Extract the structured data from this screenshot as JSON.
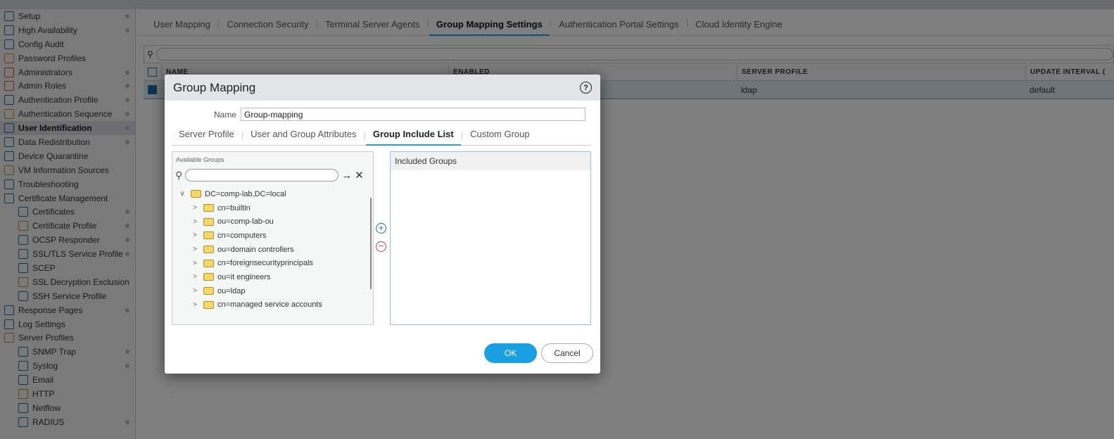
{
  "sidebar": {
    "items": [
      {
        "label": "Setup",
        "dot": true
      },
      {
        "label": "High Availability",
        "dot": true
      },
      {
        "label": "Config Audit",
        "dot": false
      },
      {
        "label": "Password Profiles",
        "dot": false
      },
      {
        "label": "Administrators",
        "dot": true
      },
      {
        "label": "Admin Roles",
        "dot": true
      },
      {
        "label": "Authentication Profile",
        "dot": true
      },
      {
        "label": "Authentication Sequence",
        "dot": true
      },
      {
        "label": "User Identification",
        "dot": true,
        "active": true
      },
      {
        "label": "Data Redistribution",
        "dot": true
      },
      {
        "label": "Device Quarantine",
        "dot": false
      },
      {
        "label": "VM Information Sources",
        "dot": false
      },
      {
        "label": "Troubleshooting",
        "dot": false
      },
      {
        "label": "Certificate Management",
        "dot": false
      },
      {
        "label": "Certificates",
        "dot": true,
        "sub": true
      },
      {
        "label": "Certificate Profile",
        "dot": true,
        "sub": true
      },
      {
        "label": "OCSP Responder",
        "dot": true,
        "sub": true
      },
      {
        "label": "SSL/TLS Service Profile",
        "dot": true,
        "sub": true
      },
      {
        "label": "SCEP",
        "dot": false,
        "sub": true
      },
      {
        "label": "SSL Decryption Exclusion",
        "dot": false,
        "sub": true
      },
      {
        "label": "SSH Service Profile",
        "dot": false,
        "sub": true
      },
      {
        "label": "Response Pages",
        "dot": true
      },
      {
        "label": "Log Settings",
        "dot": false
      },
      {
        "label": "Server Profiles",
        "dot": false
      },
      {
        "label": "SNMP Trap",
        "dot": true,
        "sub": true
      },
      {
        "label": "Syslog",
        "dot": true,
        "sub": true
      },
      {
        "label": "Email",
        "dot": false,
        "sub": true
      },
      {
        "label": "HTTP",
        "dot": false,
        "sub": true
      },
      {
        "label": "Netflow",
        "dot": false,
        "sub": true
      },
      {
        "label": "RADIUS",
        "dot": true,
        "sub": true
      }
    ]
  },
  "tabs": [
    "User Mapping",
    "Connection Security",
    "Terminal Server Agents",
    "Group Mapping Settings",
    "Authentication Portal Settings",
    "Cloud Identity Engine"
  ],
  "grid": {
    "headers": [
      "NAME",
      "ENABLED",
      "SERVER PROFILE",
      "UPDATE INTERVAL ("
    ],
    "row": [
      "",
      "",
      "ldap",
      "default"
    ]
  },
  "dialog": {
    "title": "Group Mapping",
    "help": "?",
    "name_label": "Name",
    "name_value": "Group-mapping",
    "tabs": [
      "Server Profile",
      "User and Group Attributes",
      "Group Include List",
      "Custom Group"
    ],
    "available_title": "Available Groups",
    "tree_root": "DC=comp-lab,DC=local",
    "tree": [
      "cn=builtin",
      "ou=comp-lab-ou",
      "cn=computers",
      "ou=domain controllers",
      "cn=foreignsecurityprincipals",
      "ou=it engineers",
      "ou=ldap",
      "cn=managed service accounts"
    ],
    "included_title": "Included Groups",
    "ok": "OK",
    "cancel": "Cancel"
  },
  "colors": {
    "accent": "#1a9fe0"
  }
}
